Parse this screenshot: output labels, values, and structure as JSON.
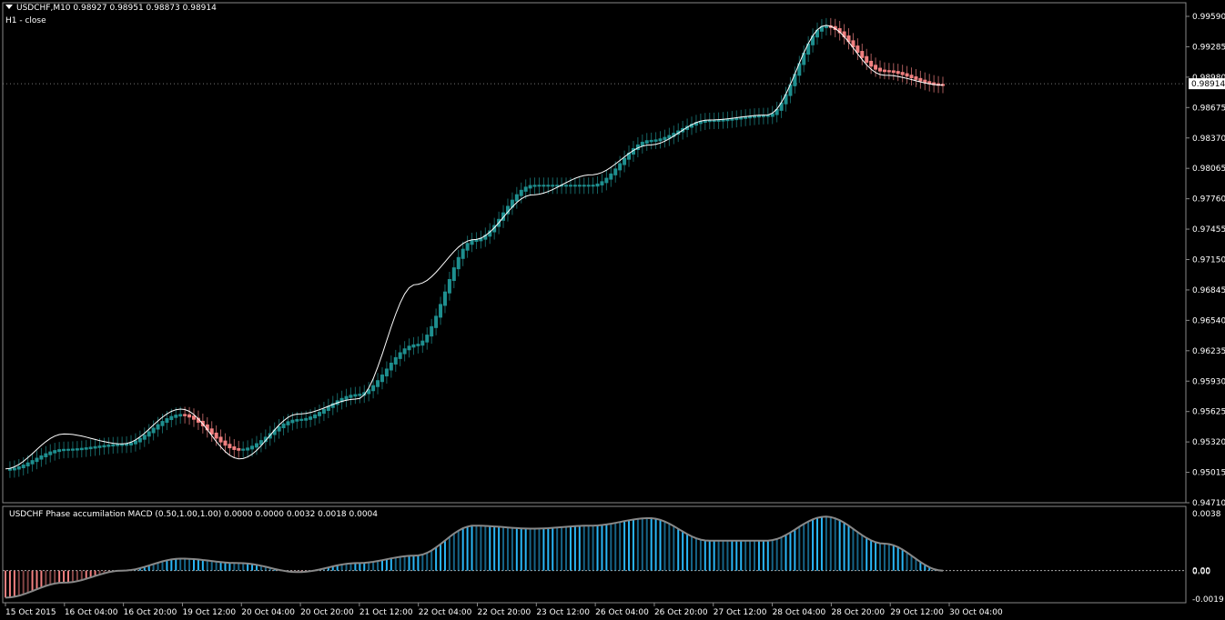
{
  "header": {
    "symbol_line": "USDCHF,M10  0.98927 0.98951 0.98873 0.98914",
    "sub_label": "H1 - close"
  },
  "subpanel": {
    "title": "USDCHF Phase accumilation MACD (0.50,1.00,1.00) 0.0000 0.0000 0.0032 0.0018 0.0004"
  },
  "colors": {
    "background": "#000000",
    "up_bar": "#1e8f8f",
    "down_bar": "#f08080",
    "close_line": "#ffffff",
    "hist_pos": "#29b6f6",
    "hist_neg": "#f08080",
    "grid": "#3a3a3a"
  },
  "chart_data": [
    {
      "type": "candlestick",
      "title": "USDCHF,M10",
      "ylim": [
        0.9471,
        0.9959
      ],
      "y_ticks": [
        "0.99590",
        "0.99285",
        "0.98980",
        "0.98675",
        "0.98370",
        "0.98065",
        "0.97760",
        "0.97455",
        "0.97150",
        "0.96845",
        "0.96540",
        "0.96235",
        "0.95930",
        "0.95625",
        "0.95320",
        "0.95015",
        "0.94710"
      ],
      "current_price": "0.98914",
      "series": [
        {
          "name": "H1 - close",
          "x": [
            "15 Oct 2015",
            "16 Oct 04:00",
            "16 Oct 20:00",
            "19 Oct 12:00",
            "20 Oct 04:00",
            "20 Oct 20:00",
            "21 Oct 12:00",
            "22 Oct 04:00",
            "22 Oct 20:00",
            "23 Oct 12:00",
            "26 Oct 04:00",
            "26 Oct 20:00",
            "27 Oct 12:00",
            "28 Oct 04:00",
            "28 Oct 20:00",
            "29 Oct 12:00",
            "30 Oct 04:00"
          ],
          "close": [
            0.9505,
            0.954,
            0.953,
            0.9565,
            0.9515,
            0.956,
            0.9575,
            0.969,
            0.9735,
            0.978,
            0.98,
            0.983,
            0.9855,
            0.986,
            0.995,
            0.99,
            0.989
          ]
        },
        {
          "name": "bars",
          "x": [
            "15 Oct 2015",
            "16 Oct 04:00",
            "16 Oct 20:00",
            "19 Oct 12:00",
            "20 Oct 04:00",
            "20 Oct 20:00",
            "21 Oct 12:00",
            "22 Oct 04:00",
            "22 Oct 20:00",
            "23 Oct 12:00",
            "26 Oct 04:00",
            "26 Oct 20:00",
            "27 Oct 12:00",
            "28 Oct 04:00",
            "28 Oct 20:00",
            "29 Oct 12:00",
            "30 Oct 04:00"
          ],
          "values": [
            0.9505,
            0.9525,
            0.953,
            0.956,
            0.9525,
            0.9555,
            0.958,
            0.963,
            0.9735,
            0.979,
            0.979,
            0.9835,
            0.9855,
            0.986,
            0.995,
            0.9905,
            0.9891
          ]
        }
      ],
      "x_ticks": [
        "15 Oct 2015",
        "16 Oct 04:00",
        "16 Oct 20:00",
        "19 Oct 12:00",
        "20 Oct 04:00",
        "20 Oct 20:00",
        "21 Oct 12:00",
        "22 Oct 04:00",
        "22 Oct 20:00",
        "23 Oct 12:00",
        "26 Oct 04:00",
        "26 Oct 20:00",
        "27 Oct 12:00",
        "28 Oct 04:00",
        "28 Oct 20:00",
        "29 Oct 12:00",
        "30 Oct 04:00"
      ]
    },
    {
      "type": "bar",
      "title": "USDCHF Phase accumilation MACD (0.50,1.00,1.00)",
      "ylim": [
        -0.0019,
        0.0038
      ],
      "y_ticks": [
        "0.0038",
        "0.00",
        "0.00",
        "-0.0019"
      ],
      "series": [
        {
          "name": "histogram",
          "x": [
            "15 Oct 2015",
            "16 Oct 04:00",
            "16 Oct 20:00",
            "19 Oct 12:00",
            "20 Oct 04:00",
            "20 Oct 20:00",
            "21 Oct 12:00",
            "22 Oct 04:00",
            "22 Oct 20:00",
            "23 Oct 12:00",
            "26 Oct 04:00",
            "26 Oct 20:00",
            "27 Oct 12:00",
            "28 Oct 04:00",
            "28 Oct 20:00",
            "29 Oct 12:00",
            "30 Oct 04:00"
          ],
          "values": [
            -0.0018,
            -0.0008,
            0.0,
            0.0008,
            0.0005,
            -0.0001,
            0.0005,
            0.001,
            0.003,
            0.0028,
            0.003,
            0.0035,
            0.002,
            0.002,
            0.0036,
            0.0018,
            0.0
          ]
        }
      ]
    }
  ]
}
